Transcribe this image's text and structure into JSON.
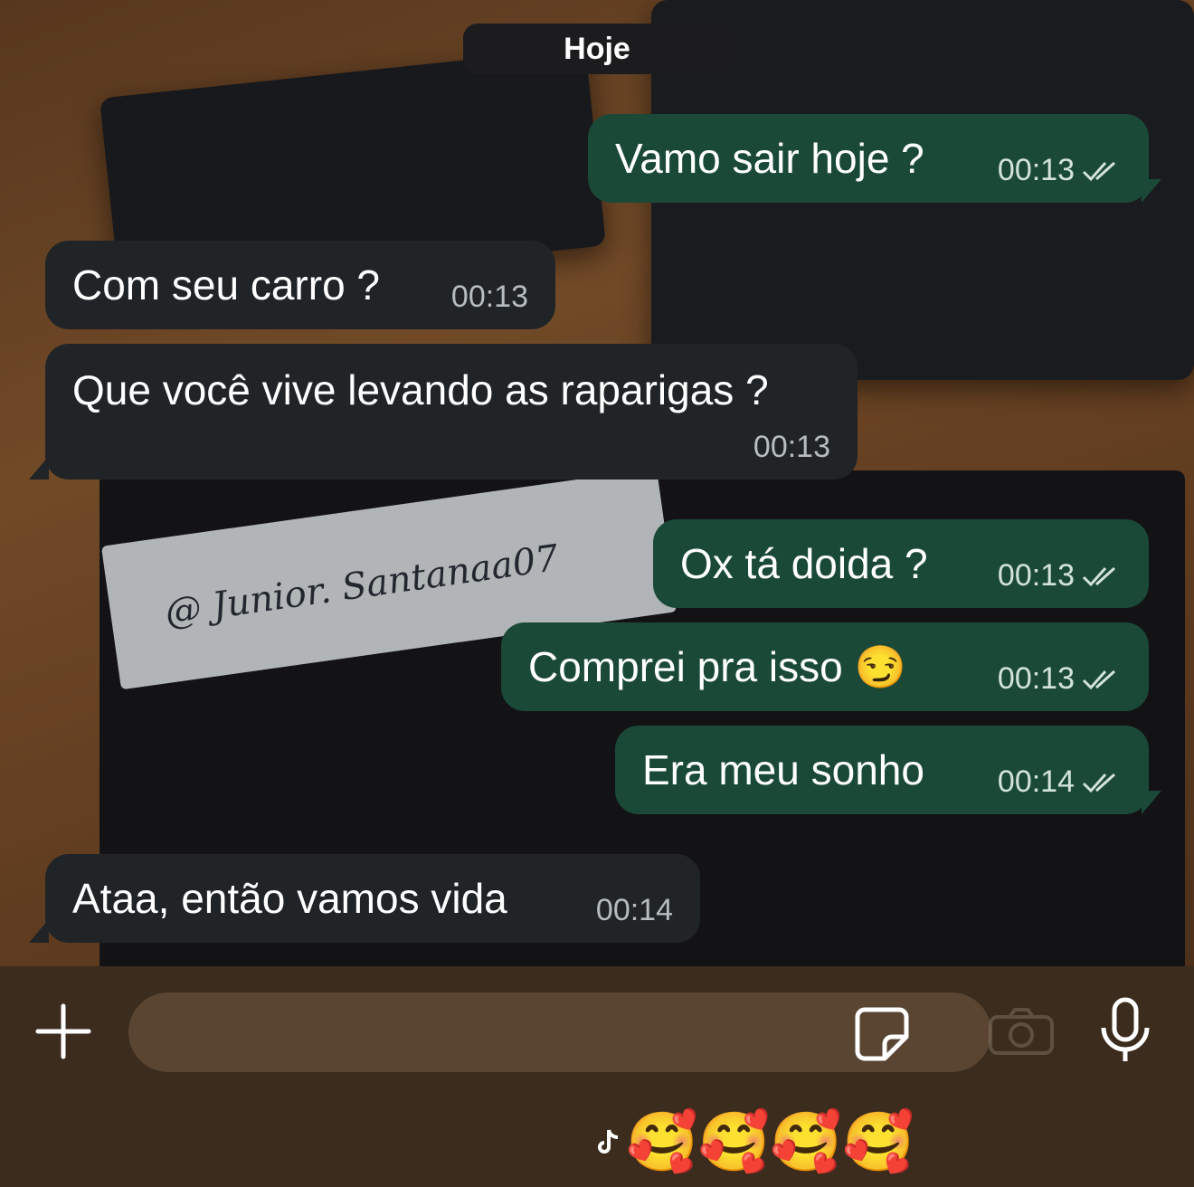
{
  "date_separator": "Hoje",
  "messages": [
    {
      "direction": "out",
      "text": "Vamo sair hoje ?",
      "time": "00:13",
      "status": "read"
    },
    {
      "direction": "in",
      "text": "Com seu carro ?",
      "time": "00:13"
    },
    {
      "direction": "in",
      "text": "Que você vive levando as raparigas ?",
      "time": "00:13"
    },
    {
      "direction": "out",
      "text": "Ox tá doida ?",
      "time": "00:13",
      "status": "read"
    },
    {
      "direction": "out",
      "text": "Comprei pra isso 😏",
      "time": "00:13",
      "status": "read"
    },
    {
      "direction": "out",
      "text": "Era meu sonho",
      "time": "00:14",
      "status": "read"
    },
    {
      "direction": "in",
      "text": "Ataa, então vamos vida",
      "time": "00:14"
    }
  ],
  "wallpaper": {
    "plate_text": "@ Junior. Santanaa07"
  },
  "composer": {
    "placeholder": "",
    "icons": [
      "plus-icon",
      "sticker-icon",
      "camera-icon",
      "microphone-icon"
    ]
  },
  "footer": {
    "emojis": "🥰🥰🥰🥰",
    "icon": "tiktok-icon"
  },
  "colors": {
    "outgoing_bubble": "#1a4a37",
    "incoming_bubble": "#202426",
    "date_pill": "#1c1c1e"
  }
}
